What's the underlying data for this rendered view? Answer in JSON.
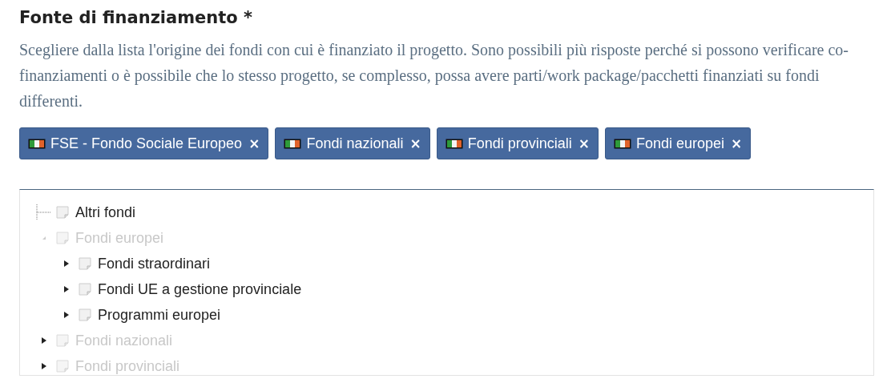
{
  "title": "Fonte di finanziamento *",
  "description": "Scegliere dalla lista l'origine dei fondi con cui è finanziato il progetto. Sono possibili più risposte perché si possono verificare co-finanziamenti o è possibile che lo stesso progetto, se complesso, possa avere parti/work package/pacchetti finanziati su fondi differenti.",
  "tags": [
    {
      "label": "FSE - Fondo Sociale Europeo",
      "remove": "×"
    },
    {
      "label": "Fondi nazionali",
      "remove": "×"
    },
    {
      "label": "Fondi provinciali",
      "remove": "×"
    },
    {
      "label": "Fondi europei",
      "remove": "×"
    }
  ],
  "tree": [
    {
      "label": "Altri fondi",
      "disabled": false
    },
    {
      "label": "Fondi europei",
      "disabled": true,
      "expanded": true,
      "children": [
        {
          "label": "Fondi straordinari",
          "disabled": false,
          "expanded": false
        },
        {
          "label": "Fondi UE a gestione provinciale",
          "disabled": false,
          "expanded": false
        },
        {
          "label": "Programmi europei",
          "disabled": false,
          "expanded": false
        }
      ]
    },
    {
      "label": "Fondi nazionali",
      "disabled": true,
      "expanded": false
    },
    {
      "label": "Fondi provinciali",
      "disabled": true,
      "expanded": false
    }
  ]
}
